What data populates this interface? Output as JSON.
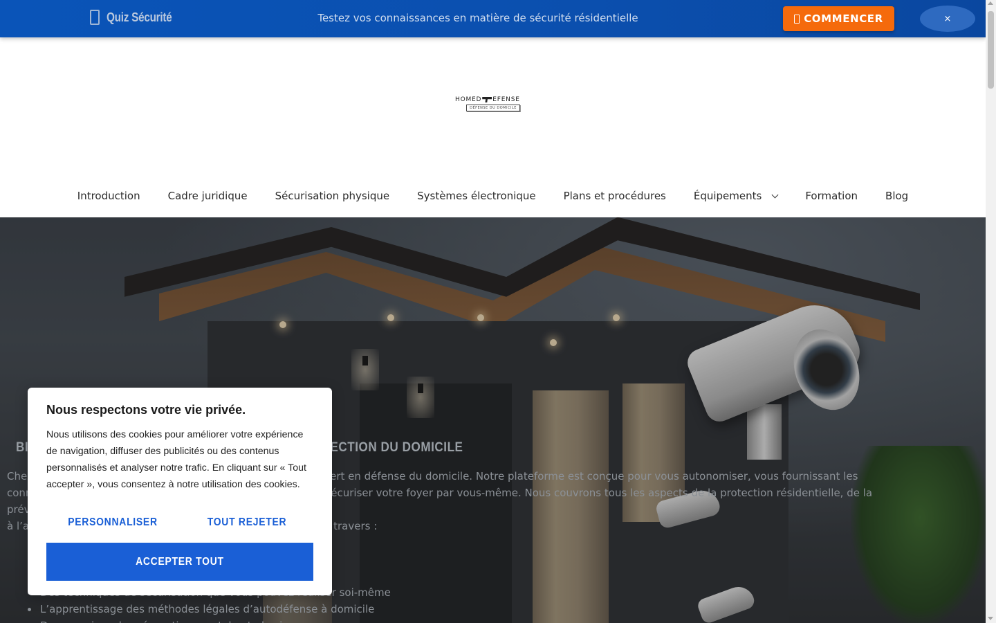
{
  "quizbar": {
    "brand_icon": "clipboard-icon",
    "title": "Quiz Sécurité",
    "tagline": "Testez vos connaissances en matière de sécurité résidentielle",
    "start_label": "COMMENCER",
    "close_label": "×",
    "colors": {
      "bar": "#0a54b8",
      "button": "#f56a0c"
    }
  },
  "logo": {
    "top_left": "HOMED",
    "top_right": "EFENSE",
    "sub": "DÉFENSE DU DOMICILE"
  },
  "nav": {
    "items": [
      {
        "label": "Introduction"
      },
      {
        "label": "Cadre juridique"
      },
      {
        "label": "Sécurisation physique"
      },
      {
        "label": "Systèmes électronique"
      },
      {
        "label": "Plans et procédures"
      },
      {
        "label": "Équipements",
        "has_dropdown": true
      },
      {
        "label": "Formation"
      },
      {
        "label": "Blog"
      }
    ]
  },
  "hero": {
    "title_left": "BI",
    "title_right": "A PROTECTION DU DOMICILE",
    "body_lines": [
      {
        "left": "Chez",
        "right": "ert en défense du domicile. Notre plateforme est conçue pour vous autonomiser, vous fournissant les"
      },
      {
        "left": "conn",
        "right": "sécuriser votre foyer par vous-même. Nous couvrons tous les aspects de la protection résidentielle, de la prévention"
      },
      {
        "left": "à l’a",
        "right": "travers :"
      }
    ],
    "list_items": [
      "Des techniques de sécurisation que vous pouvez réaliser soi-même",
      "L’apprentissage des méthodes légales d’autodéfense à domicile",
      "Des exercices de préparation mentale et physique"
    ]
  },
  "cookie": {
    "title": "Nous respectons votre vie privée.",
    "text": "Nous utilisons des cookies pour améliorer votre expérience de navigation, diffuser des publicités ou des contenus personnalisés et analyser notre trafic. En cliquant sur « Tout accepter », vous consentez à notre utilisation des cookies.",
    "customize_label": "PERSONNALISER",
    "reject_label": "TOUT REJETER",
    "accept_label": "ACCEPTER TOUT",
    "accent": "#1a5fd6"
  }
}
